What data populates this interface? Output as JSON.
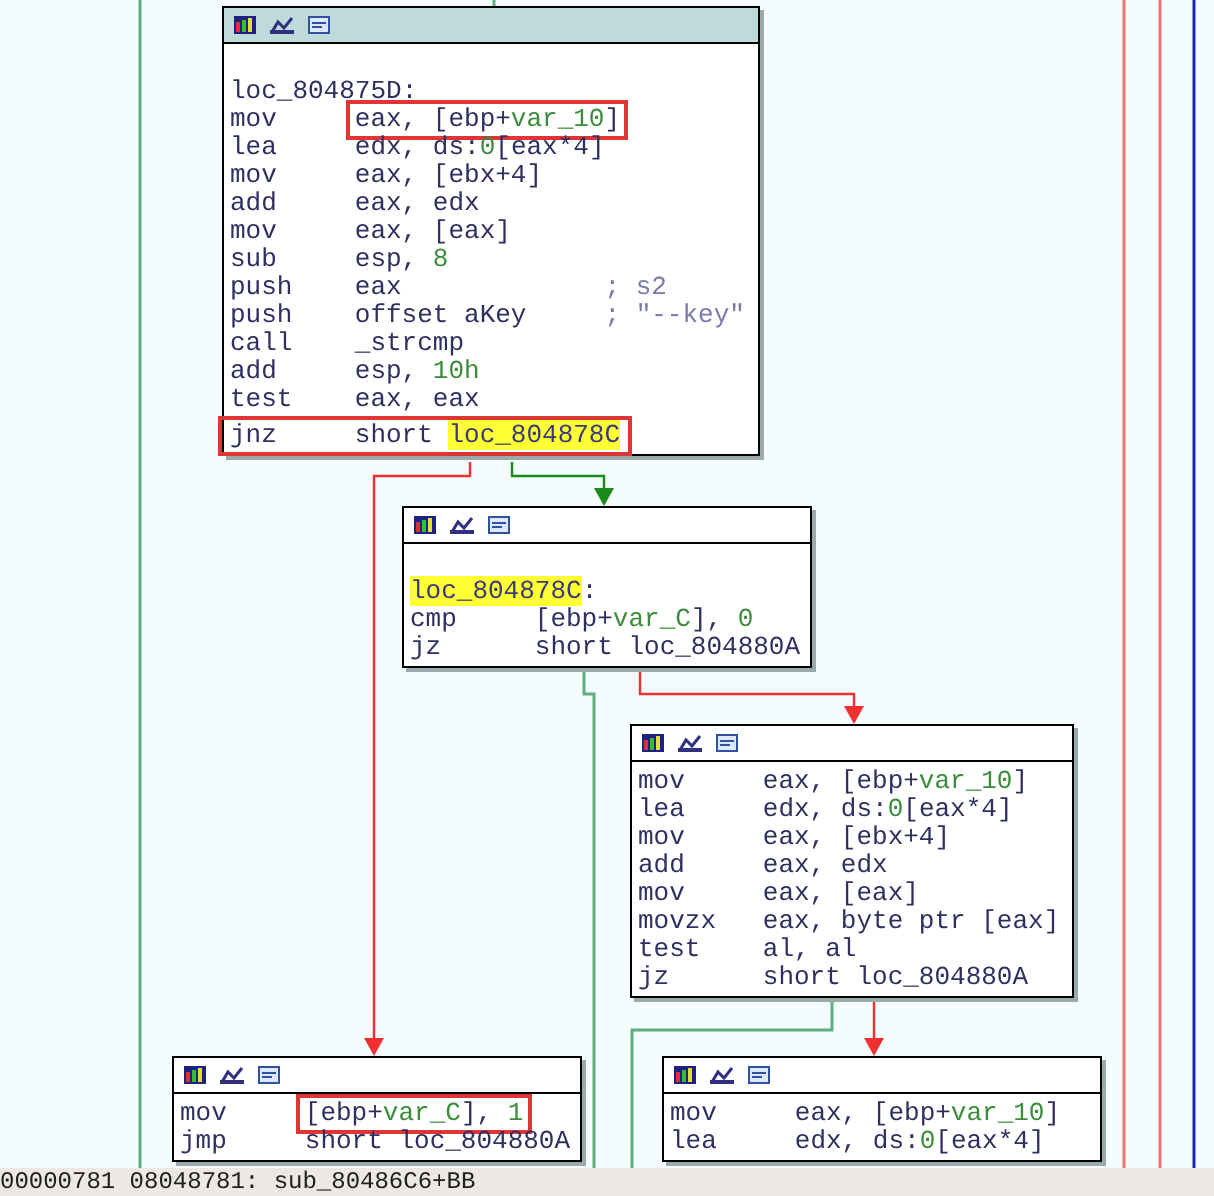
{
  "nodes": [
    {
      "selected": true,
      "label": [
        {
          "t": "loc_804875D",
          "kind": "plain"
        },
        {
          "t": ":",
          "kind": "plain"
        }
      ],
      "lines": [
        {
          "op": "mov",
          "args": [
            {
              "t": "eax, [ebp+",
              "kind": "plain"
            },
            {
              "t": "var_10",
              "kind": "var"
            },
            {
              "t": "]",
              "kind": "plain"
            }
          ],
          "args_boxed": true
        },
        {
          "op": "lea",
          "args": [
            {
              "t": "edx, ds:",
              "kind": "plain"
            },
            {
              "t": "0",
              "kind": "num"
            },
            {
              "t": "[eax*4]",
              "kind": "plain"
            }
          ]
        },
        {
          "op": "mov",
          "args": [
            {
              "t": "eax, [ebx+4]",
              "kind": "plain"
            }
          ]
        },
        {
          "op": "add",
          "args": [
            {
              "t": "eax, edx",
              "kind": "plain"
            }
          ]
        },
        {
          "op": "mov",
          "args": [
            {
              "t": "eax, [eax]",
              "kind": "plain"
            }
          ]
        },
        {
          "op": "sub",
          "args": [
            {
              "t": "esp, ",
              "kind": "plain"
            },
            {
              "t": "8",
              "kind": "num"
            }
          ]
        },
        {
          "op": "push",
          "args": [
            {
              "t": "eax",
              "kind": "plain"
            }
          ],
          "comment": "; s2"
        },
        {
          "op": "push",
          "args": [
            {
              "t": "offset aKey",
              "kind": "plain"
            }
          ],
          "comment": "; \"--key\""
        },
        {
          "op": "call",
          "args": [
            {
              "t": "_strcmp",
              "kind": "plain"
            }
          ]
        },
        {
          "op": "add",
          "args": [
            {
              "t": "esp, ",
              "kind": "plain"
            },
            {
              "t": "10h",
              "kind": "num"
            }
          ]
        },
        {
          "op": "test",
          "args": [
            {
              "t": "eax, eax",
              "kind": "plain"
            }
          ]
        },
        {
          "op": "jnz",
          "args": [
            {
              "t": "short ",
              "kind": "plain"
            },
            {
              "t": "loc_804878C",
              "kind": "hl"
            }
          ],
          "line_boxed": true
        }
      ]
    },
    {
      "selected": false,
      "label": [
        {
          "t": "loc_804878C",
          "kind": "hl"
        },
        {
          "t": ":",
          "kind": "plain"
        }
      ],
      "lines": [
        {
          "op": "cmp",
          "args": [
            {
              "t": "[ebp+",
              "kind": "plain"
            },
            {
              "t": "var_C",
              "kind": "var"
            },
            {
              "t": "], ",
              "kind": "plain"
            },
            {
              "t": "0",
              "kind": "num"
            }
          ]
        },
        {
          "op": "jz",
          "args": [
            {
              "t": "short loc_804880A",
              "kind": "plain"
            }
          ]
        }
      ]
    },
    {
      "selected": false,
      "lines": [
        {
          "op": "mov",
          "args": [
            {
              "t": "eax, [ebp+",
              "kind": "plain"
            },
            {
              "t": "var_10",
              "kind": "var"
            },
            {
              "t": "]",
              "kind": "plain"
            }
          ]
        },
        {
          "op": "lea",
          "args": [
            {
              "t": "edx, ds:",
              "kind": "plain"
            },
            {
              "t": "0",
              "kind": "num"
            },
            {
              "t": "[eax*4]",
              "kind": "plain"
            }
          ]
        },
        {
          "op": "mov",
          "args": [
            {
              "t": "eax, [ebx+4]",
              "kind": "plain"
            }
          ]
        },
        {
          "op": "add",
          "args": [
            {
              "t": "eax, edx",
              "kind": "plain"
            }
          ]
        },
        {
          "op": "mov",
          "args": [
            {
              "t": "eax, [eax]",
              "kind": "plain"
            }
          ]
        },
        {
          "op": "movzx",
          "args": [
            {
              "t": "eax, byte ptr [eax]",
              "kind": "plain"
            }
          ]
        },
        {
          "op": "test",
          "args": [
            {
              "t": "al, al",
              "kind": "plain"
            }
          ]
        },
        {
          "op": "jz",
          "args": [
            {
              "t": "short loc_804880A",
              "kind": "plain"
            }
          ]
        }
      ]
    },
    {
      "selected": false,
      "lines": [
        {
          "op": "mov",
          "args": [
            {
              "t": "[ebp+",
              "kind": "plain"
            },
            {
              "t": "var_C",
              "kind": "var"
            },
            {
              "t": "], ",
              "kind": "plain"
            },
            {
              "t": "1",
              "kind": "num"
            }
          ],
          "args_boxed": true
        },
        {
          "op": "jmp",
          "args": [
            {
              "t": "short loc_804880A",
              "kind": "plain"
            }
          ]
        }
      ]
    },
    {
      "selected": false,
      "lines": [
        {
          "op": "mov",
          "args": [
            {
              "t": "eax, [ebp+",
              "kind": "plain"
            },
            {
              "t": "var_10",
              "kind": "var"
            },
            {
              "t": "]",
              "kind": "plain"
            }
          ]
        },
        {
          "op": "lea",
          "args": [
            {
              "t": "edx, ds:",
              "kind": "plain"
            },
            {
              "t": "0",
              "kind": "num"
            },
            {
              "t": "[eax*4]",
              "kind": "plain"
            }
          ]
        }
      ]
    }
  ],
  "status_bar": "00000781 08048781: sub_80486C6+BB"
}
